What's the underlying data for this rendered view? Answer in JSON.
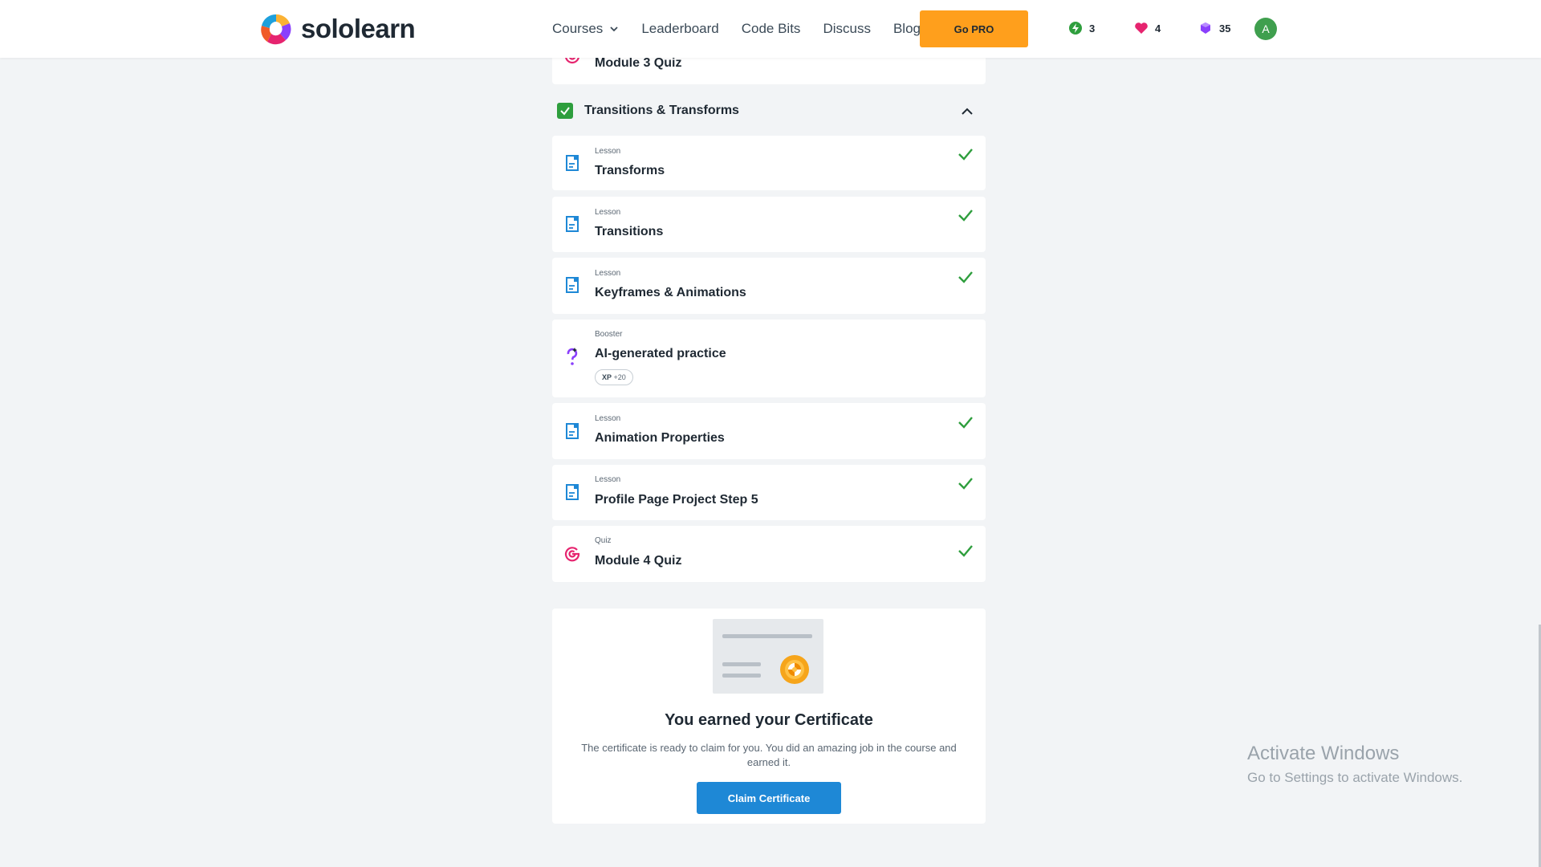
{
  "brand": {
    "name": "sololearn"
  },
  "nav": {
    "courses": "Courses",
    "leaderboard": "Leaderboard",
    "code_bits": "Code Bits",
    "discuss": "Discuss",
    "blog": "Blog",
    "go_pro": "Go PRO"
  },
  "stats": {
    "streak": "3",
    "hearts": "4",
    "bits": "35"
  },
  "user": {
    "avatar_letter": "A"
  },
  "prev_item": {
    "title": "Module 3 Quiz"
  },
  "section": {
    "title": "Transitions & Transforms",
    "completed": true
  },
  "items": [
    {
      "type": "Lesson",
      "title": "Transforms",
      "done": true
    },
    {
      "type": "Lesson",
      "title": "Transitions",
      "done": true
    },
    {
      "type": "Lesson",
      "title": "Keyframes & Animations",
      "done": true
    },
    {
      "type": "Booster",
      "title": "AI-generated practice",
      "done": false,
      "xp_label": "XP",
      "xp_value": "+20"
    },
    {
      "type": "Lesson",
      "title": "Animation Properties",
      "done": true
    },
    {
      "type": "Lesson",
      "title": "Profile Page Project Step 5",
      "done": true
    },
    {
      "type": "Quiz",
      "title": "Module 4 Quiz",
      "done": true
    }
  ],
  "certificate": {
    "title": "You earned your Certificate",
    "text": "The certificate is ready to claim for you. You did an amazing job in the course and earned it.",
    "button": "Claim Certificate"
  },
  "watermark": {
    "line1": "Activate Windows",
    "line2": "Go to Settings to activate Windows."
  },
  "colors": {
    "accent_orange": "#ff9f1c",
    "check_green": "#2e9e3d",
    "lesson_blue": "#1e88d6",
    "quiz_pink": "#e6246f",
    "booster_purple": "#8a3ffc"
  }
}
